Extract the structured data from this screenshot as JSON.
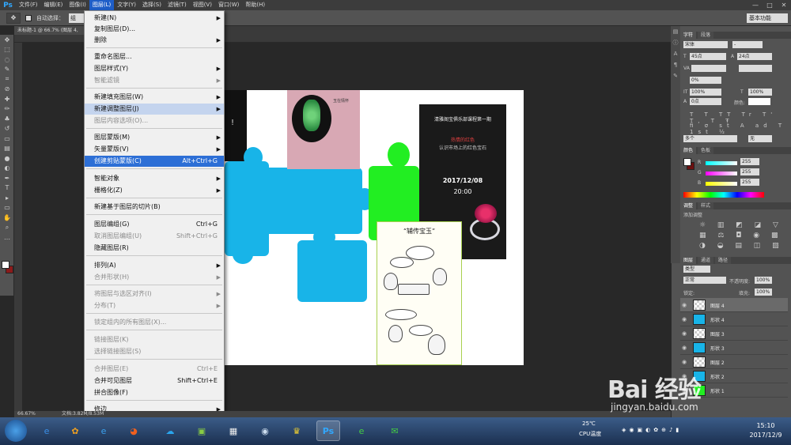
{
  "app": {
    "logo": "Ps"
  },
  "menubar": {
    "items": [
      "文件(F)",
      "编辑(E)",
      "图像(I)",
      "图层(L)",
      "文字(Y)",
      "选择(S)",
      "滤镜(T)",
      "视图(V)",
      "窗口(W)",
      "帮助(H)"
    ],
    "active_index": 3,
    "window_controls": [
      "—",
      "□",
      "✕"
    ]
  },
  "options": {
    "tool_icon": "✥",
    "auto_select_label": "自动选择：",
    "auto_select_value": "组",
    "workspace": "基本功能"
  },
  "document": {
    "tab_label": "未标题-1 @ 66.7% (图层 4, RGB/8)"
  },
  "status": {
    "zoom": "66.67%",
    "doc_info": "文档:3.82M/8.53M"
  },
  "dropdown": {
    "items": [
      {
        "label": "新建(N)",
        "shortcut": "",
        "arrow": true,
        "disabled": false
      },
      {
        "label": "复制图层(D)...",
        "shortcut": "",
        "arrow": false,
        "disabled": false
      },
      {
        "label": "删除",
        "shortcut": "",
        "arrow": true,
        "disabled": false
      },
      {
        "label": "重命名图层...",
        "shortcut": "",
        "arrow": false,
        "disabled": false
      },
      {
        "label": "图层样式(Y)",
        "shortcut": "",
        "arrow": true,
        "disabled": false
      },
      {
        "label": "智能滤镜",
        "shortcut": "",
        "arrow": true,
        "disabled": true
      },
      {
        "label": "新建填充图层(W)",
        "shortcut": "",
        "arrow": true,
        "disabled": false
      },
      {
        "label": "新建调整图层(J)",
        "shortcut": "",
        "arrow": true,
        "disabled": false
      },
      {
        "label": "图层内容选项(O)...",
        "shortcut": "",
        "arrow": false,
        "disabled": true
      },
      {
        "label": "图层蒙版(M)",
        "shortcut": "",
        "arrow": true,
        "disabled": false
      },
      {
        "label": "矢量蒙版(V)",
        "shortcut": "",
        "arrow": true,
        "disabled": false
      },
      {
        "label": "创建剪贴蒙版(C)",
        "shortcut": "Alt+Ctrl+G",
        "arrow": false,
        "disabled": false
      },
      {
        "label": "智能对象",
        "shortcut": "",
        "arrow": true,
        "disabled": false
      },
      {
        "label": "栅格化(Z)",
        "shortcut": "",
        "arrow": true,
        "disabled": false
      },
      {
        "label": "新建基于图层的切片(B)",
        "shortcut": "",
        "arrow": false,
        "disabled": false
      },
      {
        "label": "图层编组(G)",
        "shortcut": "Ctrl+G",
        "arrow": false,
        "disabled": false
      },
      {
        "label": "取消图层编组(U)",
        "shortcut": "Shift+Ctrl+G",
        "arrow": false,
        "disabled": true
      },
      {
        "label": "隐藏图层(R)",
        "shortcut": "",
        "arrow": false,
        "disabled": false
      },
      {
        "label": "排列(A)",
        "shortcut": "",
        "arrow": true,
        "disabled": false
      },
      {
        "label": "合并形状(H)",
        "shortcut": "",
        "arrow": true,
        "disabled": true
      },
      {
        "label": "将图层与选区对齐(I)",
        "shortcut": "",
        "arrow": true,
        "disabled": true
      },
      {
        "label": "分布(T)",
        "shortcut": "",
        "arrow": true,
        "disabled": true
      },
      {
        "label": "锁定组内的所有图层(X)...",
        "shortcut": "",
        "arrow": false,
        "disabled": true
      },
      {
        "label": "链接图层(K)",
        "shortcut": "",
        "arrow": false,
        "disabled": true
      },
      {
        "label": "选择链接图层(S)",
        "shortcut": "",
        "arrow": false,
        "disabled": true
      },
      {
        "label": "合并图层(E)",
        "shortcut": "Ctrl+E",
        "arrow": false,
        "disabled": true
      },
      {
        "label": "合并可见图层",
        "shortcut": "Shift+Ctrl+E",
        "arrow": false,
        "disabled": false
      },
      {
        "label": "拼合图像(F)",
        "shortcut": "",
        "arrow": false,
        "disabled": false
      },
      {
        "label": "修边",
        "shortcut": "",
        "arrow": true,
        "disabled": false
      }
    ],
    "hover_index": 7,
    "selected_index": 11
  },
  "char_panel": {
    "tabs": [
      "字符",
      "段落"
    ],
    "font_family": "宋体",
    "font_style": "-",
    "font_size": "45点",
    "leading": "24点",
    "kerning": "",
    "tracking": "0%",
    "vscale": "100%",
    "hscale": "100%",
    "baseline": "0点",
    "color_label": "颜色:",
    "lang": "美国英语",
    "aa": "浑厚",
    "aa_mode": "多个",
    "aa_value": "无"
  },
  "color_panel": {
    "tabs": [
      "颜色",
      "色板"
    ],
    "r_label": "R",
    "r_value": "255",
    "g_label": "G",
    "g_value": "255",
    "b_label": "B",
    "b_value": "255"
  },
  "adj_panel": {
    "tabs": [
      "调整",
      "样式"
    ],
    "title": "添加调整"
  },
  "layers_panel": {
    "tabs": [
      "图层",
      "通道",
      "路径"
    ],
    "kind": "类型",
    "blend": "正常",
    "opacity_label": "不透明度:",
    "opacity": "100%",
    "lock_label": "锁定:",
    "fill_label": "填充:",
    "fill": "100%",
    "layers": [
      {
        "name": "图层 4",
        "thumb": "checker",
        "selected": true
      },
      {
        "name": "形状 4",
        "thumb": "blue",
        "selected": false
      },
      {
        "name": "图层 3",
        "thumb": "checker",
        "selected": false
      },
      {
        "name": "形状 3",
        "thumb": "blue",
        "selected": false
      },
      {
        "name": "图层 2",
        "thumb": "checker",
        "selected": false
      },
      {
        "name": "形状 2",
        "thumb": "blue",
        "selected": false
      },
      {
        "name": "形状 1",
        "thumb": "green",
        "selected": false
      }
    ]
  },
  "canvas": {
    "dark_left_glyph": "!",
    "poster_title": "清雅阁宝俱乐部课程第一期",
    "poster_sub": "热情的红色",
    "poster_sub2": "认识市场上的红色宝石",
    "poster_date": "2017/12/08",
    "poster_time": "20:00",
    "jade_text": "玉在情怀",
    "comic_title": "“辅传宝玉”"
  },
  "taskbar": {
    "weather": "25℃",
    "cpu_label": "CPU温度",
    "clock_time": "15:10",
    "clock_date": "2017/12/9"
  },
  "watermark": {
    "main": "Bai 经验",
    "url": "jingyan.baidu.com"
  }
}
